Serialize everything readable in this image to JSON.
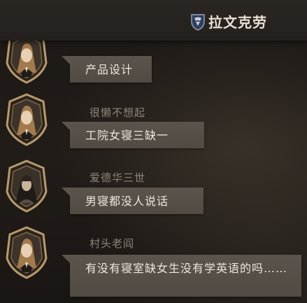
{
  "header": {
    "title": "拉文克劳"
  },
  "messages": [
    {
      "sender": "",
      "text": "产品设计"
    },
    {
      "sender": "很懒不想起",
      "text": "工院女寝三缺一"
    },
    {
      "sender": "爱德华三世",
      "text": "男寝都没人说话"
    },
    {
      "sender": "村头老阎",
      "text": "有没有寝室缺女生没有学英语的吗……"
    }
  ],
  "colors": {
    "bubble": "#5b544c",
    "frame_gold": "#b79a6e",
    "sender_text": "#8d857b",
    "header_bg": "#2a2622"
  }
}
